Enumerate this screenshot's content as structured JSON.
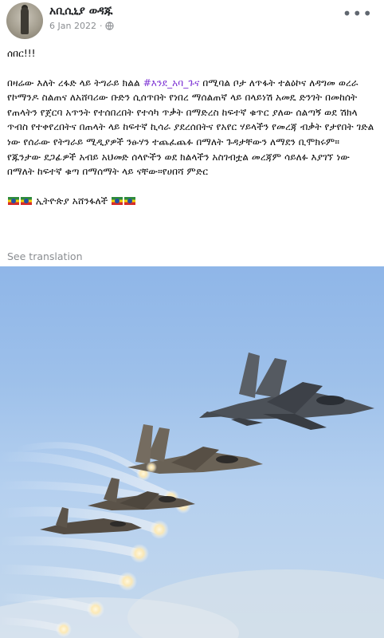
{
  "post": {
    "author_name": "አቢሲኒያ ወዳጁ",
    "date": "6 Jan 2022",
    "date_separator": "·",
    "more_label": "•••",
    "text_line1": "ሰበር!!!",
    "paragraph_before_hashtag": "በዛሬው እለት ረፋድ ላይ ትግራይ ክልል ",
    "hashtag": "#እንደ_አባ_ጉና",
    "paragraph_after_hashtag": " በሚባል ቦታ ለጥፋት ተልዕኮና ለዳግመ ወረራ የኮማንዶ ስልጠና ለአሸባሪው ቡድን ሲሰጥበት የነበረ ማሰልጠኛ ላይ በላይነሽ አመዴ ድንገት በመከሰት የጠላትን የጀርባ አጥንት የተሰበረበት የተሳካ ጥቃት በማድረስ ከፍተኛ ቁጥር ያለው ሰልጣኝ ወደ ሽክላ ጥብስ የተቀየረበትና በጠላት ላይ ከፍተኛ ኪሳራ ያደረሰበትና የአየር ሃይላችን የመረጃ ብቃት የታየበት ገድል ነው የሰራው የትግራይ ሚዲያዎች ንፁሃን ተጨፈጨፉ በማለት ጉዳታቸውን ለማደን ቢሞክሩም። የጁንታው ደጋፊዎች አብይ አህመድ ሰላዮችን ወደ ክልላችን አስገብቷል መረጃም ሳይለፉ እያገኘ ነው በማለት ከፍተኛ ቁጣ በማሰማት ላይ ናቸው።የሀበሻ ምድር",
    "closing_text": " ኢትዮጵያ አሸንፋለች ",
    "see_translation": "See translation"
  },
  "colors": {
    "hashtag": "#7b2fd3",
    "meta_gray": "#8a8d91",
    "sky_top": "#8fb6e8",
    "sky_bottom": "#c4d8ec"
  },
  "icons": {
    "privacy": "globe-icon",
    "more": "more-options-icon",
    "flag": "ethiopia-flag-emoji"
  }
}
